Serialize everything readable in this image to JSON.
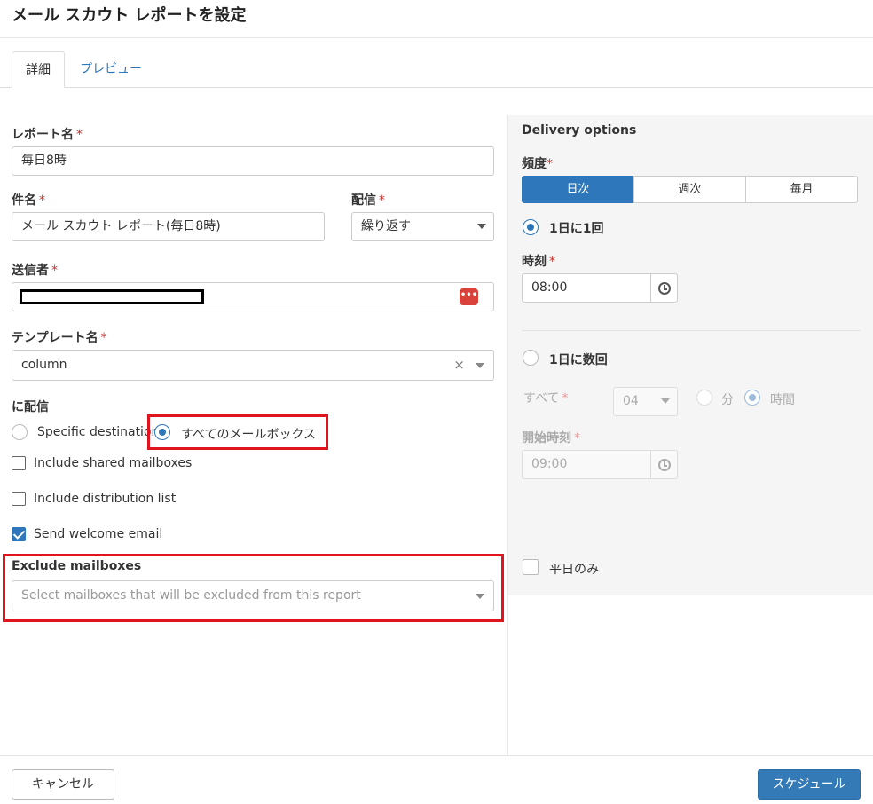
{
  "dialog": {
    "title": "メール スカウト レポートを設定"
  },
  "tabs": [
    {
      "label": "詳細"
    },
    {
      "label": "プレビュー"
    }
  ],
  "form": {
    "report_name": {
      "label": "レポート名",
      "value": "毎日8時"
    },
    "subject": {
      "label": "件名",
      "value": "メール スカウト レポート(毎日8時)"
    },
    "delivery": {
      "label": "配信",
      "value": "繰り返す"
    },
    "sender": {
      "label": "送信者"
    },
    "template": {
      "label": "テンプレート名",
      "value": "column",
      "clear": "×"
    },
    "deliver_to": {
      "label": "に配信",
      "specific": "Specific destination",
      "all": "すべてのメールボックス"
    },
    "include_shared": "Include shared mailboxes",
    "include_distribution": "Include distribution list",
    "send_welcome": "Send welcome email",
    "exclude": {
      "label": "Exclude mailboxes",
      "placeholder": "Select mailboxes that will be excluded from this report"
    },
    "required_mark": "*"
  },
  "delivery_options": {
    "title": "Delivery options",
    "frequency_label": "頻度",
    "frequency": [
      "日次",
      "週次",
      "毎月"
    ],
    "once_label": "1日に1回",
    "time_label": "時刻",
    "time_value": "08:00",
    "multi_label": "1日に数回",
    "every_label": "すべて",
    "every_value": "04",
    "unit_min": "分",
    "unit_hour": "時間",
    "start_label": "開始時刻",
    "start_value": "09:00",
    "weekdays_label": "平日のみ"
  },
  "footer": {
    "cancel": "キャンセル",
    "schedule": "スケジュール"
  },
  "colors": {
    "accent": "#2e77bb",
    "highlight": "#e0141e",
    "required": "#c9302c"
  }
}
